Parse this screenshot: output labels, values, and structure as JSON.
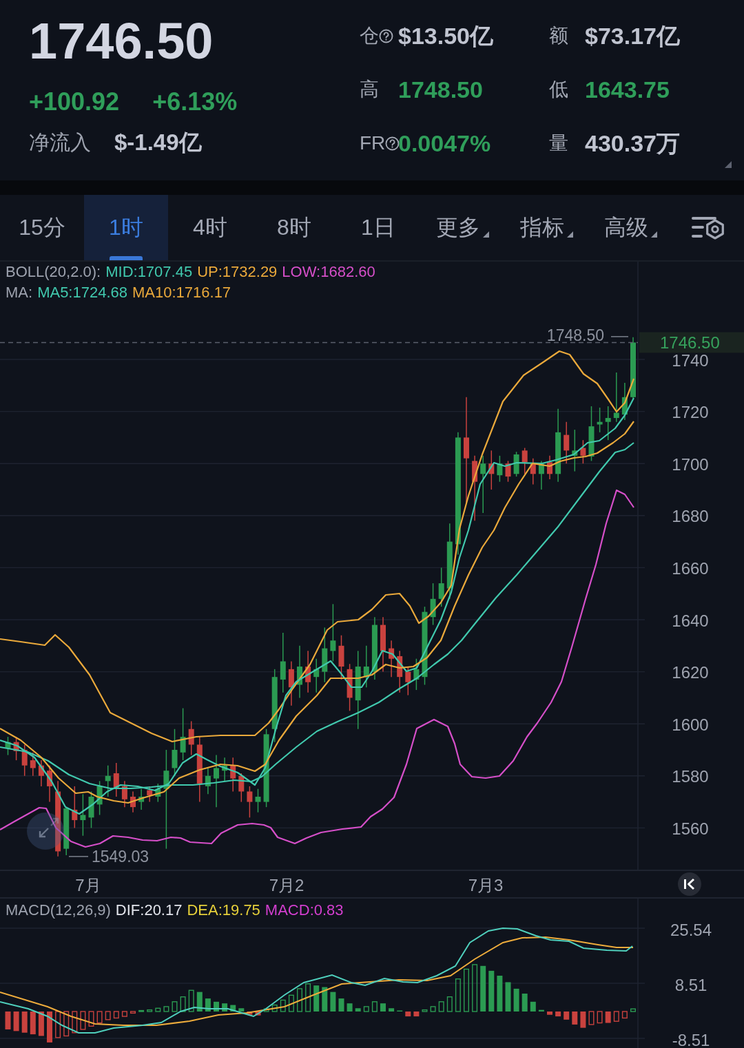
{
  "quote": {
    "price": "1746.50",
    "change": "+100.92",
    "change_percent": "+6.13%",
    "positive": true,
    "net_inflow_label": "净流入",
    "net_inflow": "$-1.49亿"
  },
  "stats": [
    {
      "label": "仓",
      "help": true,
      "value": "$13.50亿",
      "color": "#c0c4d0"
    },
    {
      "label": "额",
      "help": false,
      "value": "$73.17亿",
      "color": "#c0c4d0"
    },
    {
      "label": "高",
      "help": false,
      "value": "1748.50",
      "color": "#2f9e5a"
    },
    {
      "label": "低",
      "help": false,
      "value": "1643.75",
      "color": "#2f9e5a"
    },
    {
      "label": "FR",
      "help": true,
      "value": "0.0047%",
      "color": "#2f9e5a"
    },
    {
      "label": "量",
      "help": false,
      "value": "430.37万",
      "color": "#c0c4d0"
    }
  ],
  "tabs": [
    {
      "label": "15分",
      "selected": false,
      "dropdown": false
    },
    {
      "label": "1时",
      "selected": true,
      "dropdown": false
    },
    {
      "label": "4时",
      "selected": false,
      "dropdown": false
    },
    {
      "label": "8时",
      "selected": false,
      "dropdown": false
    },
    {
      "label": "1日",
      "selected": false,
      "dropdown": false
    },
    {
      "label": "更多",
      "selected": false,
      "dropdown": true
    },
    {
      "label": "指标",
      "selected": false,
      "dropdown": true
    },
    {
      "label": "高级",
      "selected": false,
      "dropdown": true
    }
  ],
  "price_chart": {
    "legends": [
      {
        "label": "BOLL(20,2.0):",
        "items": [
          {
            "text": "MID:1707.45",
            "color": "#41c9ae"
          },
          {
            "text": "UP:1732.29",
            "color": "#eaa93b"
          },
          {
            "text": "LOW:1682.60",
            "color": "#d64fc9"
          }
        ]
      },
      {
        "label": "MA:",
        "items": [
          {
            "text": "MA5:1724.68",
            "color": "#41c9ae"
          },
          {
            "text": "MA10:1716.17",
            "color": "#eaa93b"
          }
        ]
      }
    ],
    "high_marker": "1748.50",
    "low_marker": "1549.03",
    "last_price": "1746.50",
    "y_axis": [
      "1740",
      "1720",
      "1700",
      "1680",
      "1660",
      "1640",
      "1620",
      "1600",
      "1580",
      "1560"
    ],
    "x_axis": [
      "7月",
      "7月2",
      "7月3"
    ]
  },
  "macd_chart": {
    "label": "MACD(12,26,9)",
    "items": [
      {
        "text": "DIF:20.17",
        "color": "#e3e5ec"
      },
      {
        "text": "DEA:19.75",
        "color": "#e6d03a"
      },
      {
        "text": "MACD:0.83",
        "color": "#d43fd0"
      }
    ],
    "y_axis": [
      "25.54",
      "8.51",
      "-8.51"
    ]
  }
}
